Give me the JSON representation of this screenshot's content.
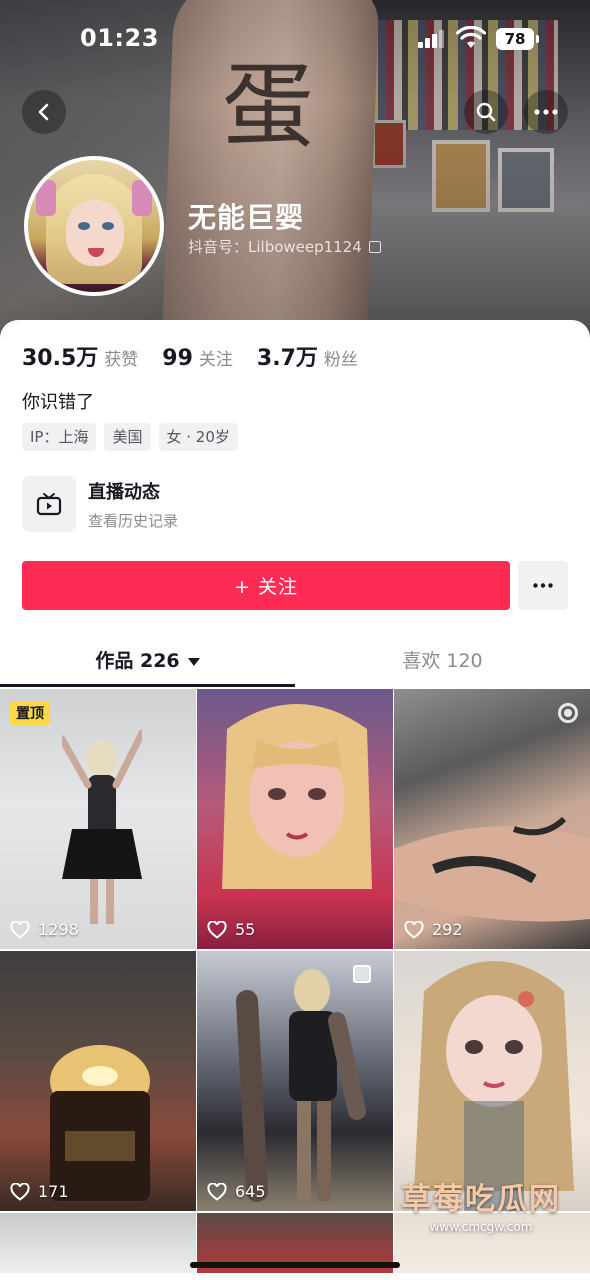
{
  "status_bar": {
    "time": "01:23",
    "battery": "78"
  },
  "profile": {
    "nickname": "无能巨婴",
    "douyin_id": "抖音号：Lilboweep1124",
    "banner_text": "蛋",
    "stats": [
      {
        "value": "30.5万",
        "label": "获赞"
      },
      {
        "value": "99",
        "label": "关注"
      },
      {
        "value": "3.7万",
        "label": "粉丝"
      }
    ],
    "bio": "你识错了",
    "tags": [
      "IP：上海",
      "美国",
      "女 · 20岁"
    ]
  },
  "live": {
    "title": "直播动态",
    "subtitle": "查看历史记录"
  },
  "follow_button": "+ 关注",
  "tabs": [
    {
      "label": "作品 226"
    },
    {
      "label": "喜欢 120"
    }
  ],
  "videos": [
    {
      "likes": "1298",
      "pinned_label": "置顶"
    },
    {
      "likes": "55"
    },
    {
      "likes": "292"
    },
    {
      "likes": "171"
    },
    {
      "likes": "645"
    },
    {
      "likes": ""
    }
  ],
  "watermark": {
    "title": "草莓吃瓜网",
    "url": "www.cmcgw.com"
  },
  "colors": {
    "accent": "#fe2c55",
    "pin": "#f9d84a",
    "text": "#161823",
    "muted": "#8a8b91"
  }
}
